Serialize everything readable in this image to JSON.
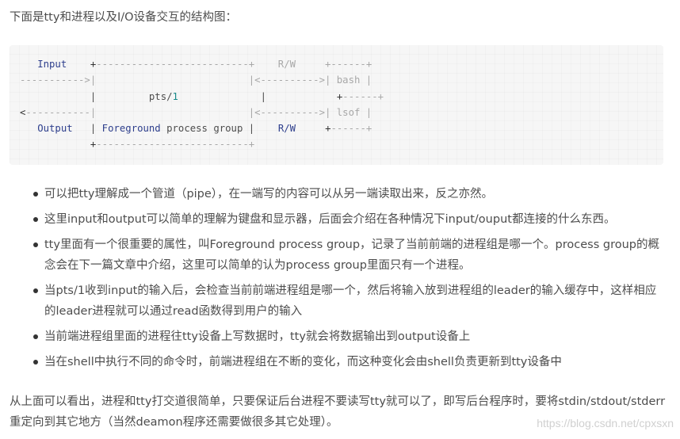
{
  "intro": "下面是tty和进程以及I/O设备交互的结构图：",
  "diagram": {
    "lines": [
      [
        {
          "t": "   "
        },
        {
          "t": "Input",
          "c": "kw"
        },
        {
          "t": "    "
        },
        {
          "t": "+",
          "c": "dk"
        },
        {
          "t": "--------------------------+    R/W     +------+"
        }
      ],
      [
        {
          "t": "----------->|                          |<---------->| bash |"
        }
      ],
      [
        {
          "t": "            "
        },
        {
          "t": "|",
          "c": "txt"
        },
        {
          "t": "         "
        },
        {
          "t": "pts/",
          "c": "txt"
        },
        {
          "t": "1",
          "c": "num"
        },
        {
          "t": "              "
        },
        {
          "t": "|",
          "c": "txt"
        },
        {
          "t": "            "
        },
        {
          "t": "+",
          "c": "dk"
        },
        {
          "t": "------+"
        }
      ],
      [
        {
          "t": "<",
          "c": "dk"
        },
        {
          "t": "-----------|                          |<---------->| lsof |"
        }
      ],
      [
        {
          "t": "   "
        },
        {
          "t": "Output",
          "c": "kw"
        },
        {
          "t": "   "
        },
        {
          "t": "|",
          "c": "txt"
        },
        {
          "t": " "
        },
        {
          "t": "Foreground",
          "c": "kw"
        },
        {
          "t": " "
        },
        {
          "t": "process group",
          "c": "txt"
        },
        {
          "t": " "
        },
        {
          "t": "|",
          "c": "txt"
        },
        {
          "t": "    "
        },
        {
          "t": "R/W",
          "c": "kw"
        },
        {
          "t": "     "
        },
        {
          "t": "+",
          "c": "dk"
        },
        {
          "t": "------+"
        }
      ],
      [
        {
          "t": "            "
        },
        {
          "t": "+",
          "c": "dk"
        },
        {
          "t": "--------------------------+"
        }
      ]
    ],
    "labels": {
      "input": "Input",
      "output": "Output",
      "device": "pts/1",
      "group": "Foreground process group",
      "rw": "R/W",
      "proc1": "bash",
      "proc2": "lsof"
    }
  },
  "points": [
    "可以把tty理解成一个管道（pipe），在一端写的内容可以从另一端读取出来，反之亦然。",
    "这里input和output可以简单的理解为键盘和显示器，后面会介绍在各种情况下input/ouput都连接的什么东西。",
    "tty里面有一个很重要的属性，叫Foreground process group，记录了当前前端的进程组是哪一个。process group的概念会在下一篇文章中介绍，这里可以简单的认为process group里面只有一个进程。",
    "当pts/1收到input的输入后，会检查当前前端进程组是哪一个，然后将输入放到进程组的leader的输入缓存中，这样相应的leader进程就可以通过read函数得到用户的输入",
    "当前端进程组里面的进程往tty设备上写数据时，tty就会将数据输出到output设备上",
    "当在shell中执行不同的命令时，前端进程组在不断的变化，而这种变化会由shell负责更新到tty设备中"
  ],
  "outro": "从上面可以看出，进程和tty打交道很简单，只要保证后台进程不要读写tty就可以了，即写后台程序时，要将stdin/stdout/stderr重定向到其它地方（当然deamon程序还需要做很多其它处理）。",
  "watermark": "https://blog.csdn.net/cpxsxn"
}
